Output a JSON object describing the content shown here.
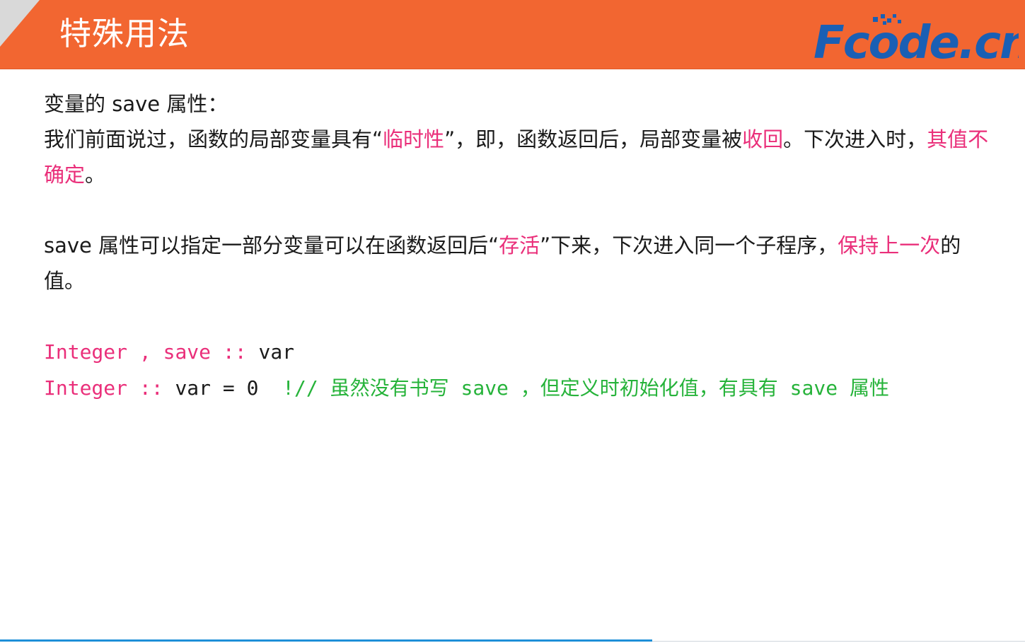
{
  "header": {
    "title": "特殊用法",
    "logo_text": "Fcode.cn",
    "background_color": "#f26631"
  },
  "content": {
    "intro_heading": "变量的 save 属性：",
    "para1": {
      "part1": "我们前面说过，函数的局部变量具有",
      "quote_open": "“",
      "highlight1": "临时性",
      "quote_close": "”",
      "part2": "，即，函数返回后，局部变量被",
      "highlight2": "收回",
      "part3": "。下次进入时，",
      "highlight3": "其值不确定",
      "part4": "。"
    },
    "para2": {
      "part1": "save 属性可以指定一部分变量可以在函数返回后",
      "quote_open": "“",
      "highlight1": "存活",
      "quote_close": "”",
      "part2": "下来，下次进入同一个子程序，",
      "highlight2": "保持上一次",
      "part3": "的值。"
    },
    "code": {
      "line1": {
        "kw1": "Integer",
        "sep": " , ",
        "kw2": "save",
        "op": " :: ",
        "rest": "var"
      },
      "line2": {
        "kw1": "Integer",
        "op": " :: ",
        "rest": "var = 0  ",
        "comment_mark": "!// ",
        "comment_text1": "虽然没有书写",
        "comment_kw1": " save ",
        "comment_text2": "，但定义时初始化值，有具有",
        "comment_kw2": " save ",
        "comment_text3": "属性"
      }
    }
  },
  "colors": {
    "highlight": "#ea2f7a",
    "comment": "#26b33a",
    "logo_blue": "#1a5fb4",
    "accent_line": "#1e8fd8"
  }
}
